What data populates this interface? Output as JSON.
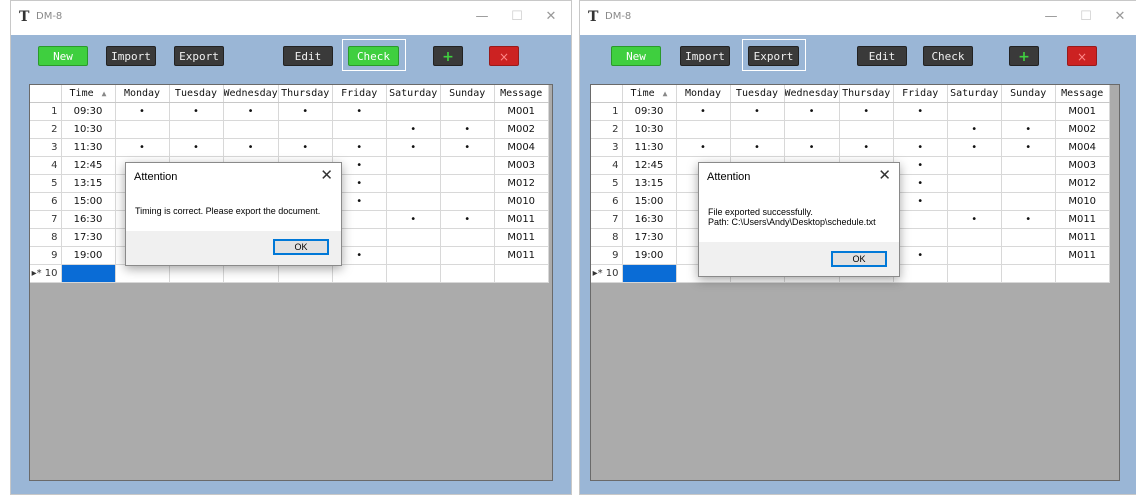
{
  "app": {
    "logo": "T",
    "title": "DM-8"
  },
  "window_controls": {
    "minimize": "—",
    "maximize": "☐",
    "close": "✕"
  },
  "toolbar": {
    "new": "New",
    "import": "Import",
    "export": "Export",
    "edit": "Edit",
    "check": "Check",
    "add": "+",
    "delete": "×"
  },
  "grid": {
    "columns": [
      "Time",
      "Monday",
      "Tuesday",
      "Wednesday",
      "Thursday",
      "Friday",
      "Saturday",
      "Sunday",
      "Message"
    ],
    "rows": [
      {
        "n": "1",
        "time": "09:30",
        "days": [
          "•",
          "•",
          "•",
          "•",
          "•",
          "",
          ""
        ],
        "msg": "M001"
      },
      {
        "n": "2",
        "time": "10:30",
        "days": [
          "",
          "",
          "",
          "",
          "",
          "•",
          "•"
        ],
        "msg": "M002"
      },
      {
        "n": "3",
        "time": "11:30",
        "days": [
          "•",
          "•",
          "•",
          "•",
          "•",
          "•",
          "•"
        ],
        "msg": "M004"
      },
      {
        "n": "4",
        "time": "12:45",
        "days": [
          "",
          "",
          "",
          "",
          "•",
          "",
          ""
        ],
        "msg": "M003"
      },
      {
        "n": "5",
        "time": "13:15",
        "days": [
          "",
          "",
          "",
          "",
          "•",
          "",
          ""
        ],
        "msg": "M012"
      },
      {
        "n": "6",
        "time": "15:00",
        "days": [
          "",
          "",
          "",
          "",
          "•",
          "",
          ""
        ],
        "msg": "M010"
      },
      {
        "n": "7",
        "time": "16:30",
        "days": [
          "",
          "",
          "",
          "",
          "",
          "•",
          "•"
        ],
        "msg": "M011"
      },
      {
        "n": "8",
        "time": "17:30",
        "days": [
          "",
          "",
          "",
          "",
          "",
          "",
          ""
        ],
        "msg": "M011"
      },
      {
        "n": "9",
        "time": "19:00",
        "days": [
          "",
          "",
          "",
          "",
          "•",
          "",
          ""
        ],
        "msg": "M011"
      },
      {
        "n": "▸* 10",
        "time": "",
        "days": [
          "",
          "",
          "",
          "",
          "",
          "",
          ""
        ],
        "msg": "",
        "new": true
      }
    ]
  },
  "dialogs": [
    {
      "title": "Attention",
      "close": "✕",
      "lines": [
        "Timing is correct. Please export the document."
      ],
      "ok": "OK"
    },
    {
      "title": "Attention",
      "close": "✕",
      "lines": [
        "File exported successfully.",
        "Path: C:\\Users\\Andy\\Desktop\\schedule.txt"
      ],
      "ok": "OK"
    }
  ]
}
